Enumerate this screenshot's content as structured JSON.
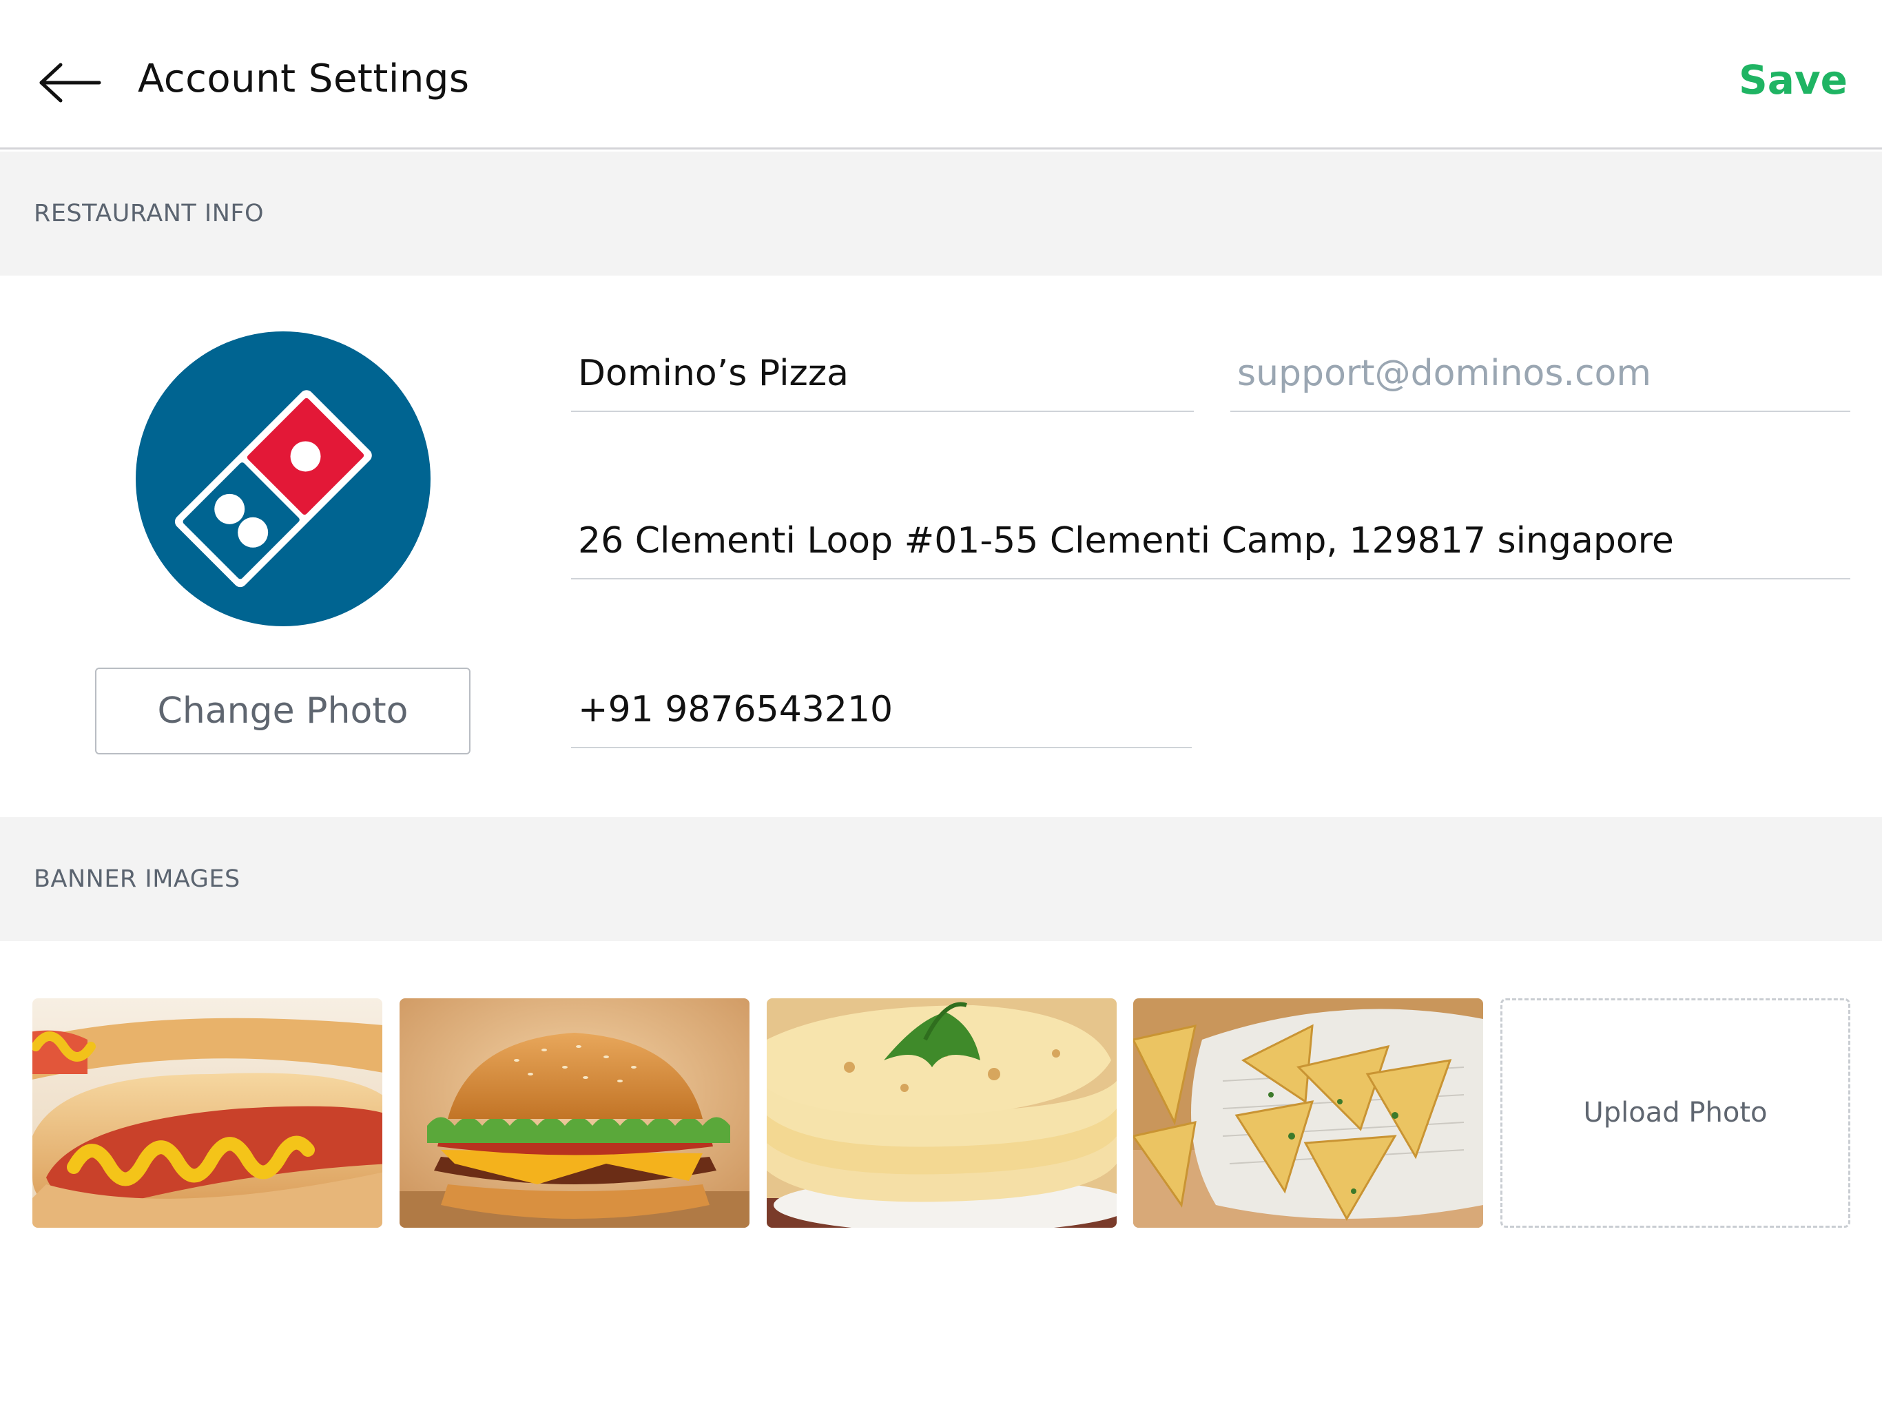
{
  "header": {
    "title": "Account Settings",
    "save_label": "Save",
    "back_icon": "arrow-left-icon",
    "accent_color": "#1fb463"
  },
  "restaurant_info": {
    "section_label": "RESTAURANT INFO",
    "name": "Domino’s Pizza",
    "email_placeholder": "support@dominos.com",
    "address": "26 Clementi Loop #01-55 Clementi Camp, 129817 singapore",
    "phone": "+91 9876543210",
    "change_photo_label": "Change Photo",
    "logo": {
      "icon": "dominos-logo",
      "background_color": "#006491",
      "tile_red": "#e31837"
    }
  },
  "banner_images": {
    "section_label": "BANNER IMAGES",
    "images": [
      {
        "subject": "hot-dog"
      },
      {
        "subject": "burger"
      },
      {
        "subject": "flatbread"
      },
      {
        "subject": "samosas"
      }
    ],
    "upload_label": "Upload Photo"
  }
}
